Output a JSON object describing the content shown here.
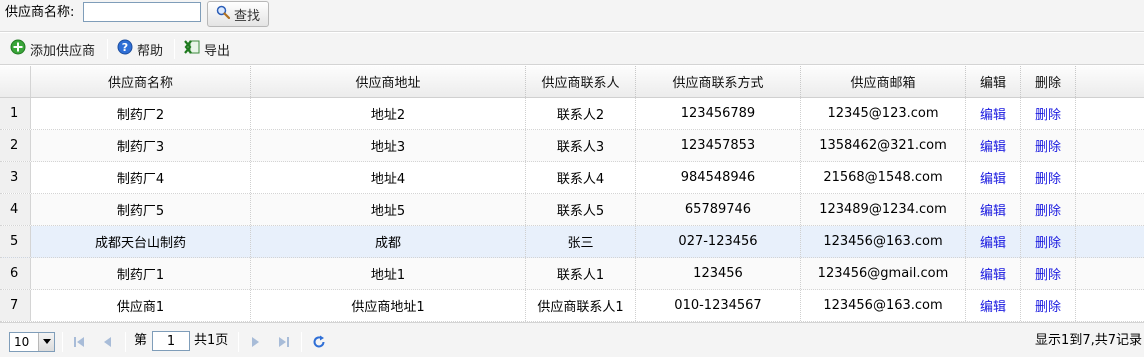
{
  "search": {
    "label": "供应商名称:",
    "value": "",
    "button_label": "查找"
  },
  "toolbar": {
    "add_label": "添加供应商",
    "help_label": "帮助",
    "export_label": "导出"
  },
  "table": {
    "columns": [
      "供应商名称",
      "供应商地址",
      "供应商联系人",
      "供应商联系方式",
      "供应商邮箱",
      "编辑",
      "删除"
    ],
    "rows": [
      {
        "num": "1",
        "name": "制药厂2",
        "address": "地址2",
        "contact": "联系人2",
        "phone": "123456789",
        "email": "12345@123.com",
        "edit": "编辑",
        "delete": "删除"
      },
      {
        "num": "2",
        "name": "制药厂3",
        "address": "地址3",
        "contact": "联系人3",
        "phone": "123457853",
        "email": "1358462@321.com",
        "edit": "编辑",
        "delete": "删除"
      },
      {
        "num": "3",
        "name": "制药厂4",
        "address": "地址4",
        "contact": "联系人4",
        "phone": "984548946",
        "email": "21568@1548.com",
        "edit": "编辑",
        "delete": "删除"
      },
      {
        "num": "4",
        "name": "制药厂5",
        "address": "地址5",
        "contact": "联系人5",
        "phone": "65789746",
        "email": "123489@1234.com",
        "edit": "编辑",
        "delete": "删除"
      },
      {
        "num": "5",
        "name": "成都天台山制药",
        "address": "成都",
        "contact": "张三",
        "phone": "027-123456",
        "email": "123456@163.com",
        "edit": "编辑",
        "delete": "删除"
      },
      {
        "num": "6",
        "name": "制药厂1",
        "address": "地址1",
        "contact": "联系人1",
        "phone": "123456",
        "email": "123456@gmail.com",
        "edit": "编辑",
        "delete": "删除"
      },
      {
        "num": "7",
        "name": "供应商1",
        "address": "供应商地址1",
        "contact": "供应商联系人1",
        "phone": "010-1234567",
        "email": "123456@163.com",
        "edit": "编辑",
        "delete": "删除"
      }
    ]
  },
  "pager": {
    "page_size": "10",
    "page_prefix": "第",
    "current_page": "1",
    "page_suffix": "共1页",
    "info": "显示1到7,共7记录"
  },
  "colors": {
    "link": "#1a1ae0",
    "highlight_row": "#e8f0fb",
    "toolbar_bg": "#f4f4f4"
  },
  "icons": {
    "search_button": "magnifier-icon",
    "add": "green-plus-icon",
    "help": "blue-question-icon",
    "export": "excel-x-icon",
    "pager": [
      "first-page-icon",
      "prev-page-icon",
      "next-page-icon",
      "last-page-icon",
      "refresh-icon"
    ]
  }
}
